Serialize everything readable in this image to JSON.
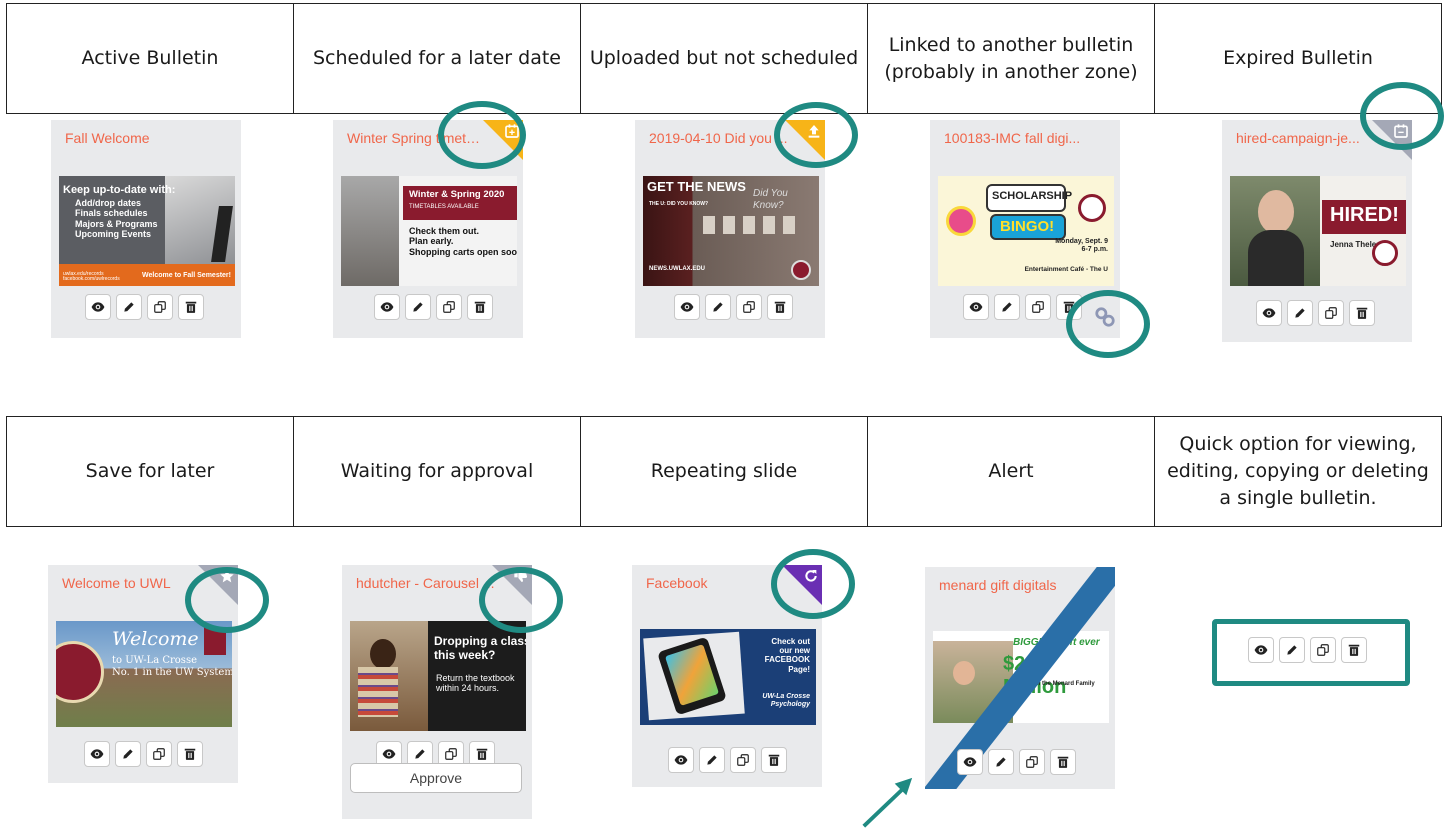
{
  "legend": {
    "row1": [
      "Active Bulletin",
      "Scheduled for a later date",
      "Uploaded but not scheduled",
      "Linked to another bulletin (probably in another zone)",
      "Expired Bulletin"
    ],
    "row2": [
      "Save for later",
      "Waiting for approval",
      "Repeating slide",
      "Alert",
      "Quick option for viewing, editing, copying or deleting a single bulletin."
    ]
  },
  "cards": {
    "active": {
      "title": "Fall Welcome",
      "thumb": {
        "line1": "Keep up-to-date with:",
        "items": "Add/drop dates\nFinals schedules\nMajors & Programs\nUpcoming Events",
        "footer_left": "uwlax.edu/records\nfacebook.com/uwlrecords",
        "footer_right": "Welcome to Fall Semester!"
      }
    },
    "scheduled": {
      "title": "Winter Spring timetables",
      "thumb": {
        "head": "Winter & Spring 2020",
        "sub": "TIMETABLES AVAILABLE",
        "body": "Check them out.\nPlan early.\nShopping carts open soon!"
      }
    },
    "uploaded": {
      "title": "2019-04-10 Did you ...",
      "thumb": {
        "head": "GET THE NEWS",
        "sub": "THE U: DID YOU KNOW?",
        "url": "NEWS.UWLAX.EDU",
        "wall": "Did You Know?"
      }
    },
    "linked": {
      "title": "100183-IMC fall digi...",
      "thumb": {
        "head": "SCHOLARSHIP",
        "bingo": "BINGO!",
        "date": "Monday, Sept. 9\n6-7 p.m.",
        "place": "Entertainment Café - The U"
      }
    },
    "expired": {
      "title": "hired-campaign-je...",
      "thumb": {
        "hired": "HIRED!",
        "name": "Jenna Thelen"
      }
    },
    "save": {
      "title": "Welcome to UWL",
      "thumb": {
        "head": "Welcome",
        "sub": "to UW-La Crosse\nNo. 1 in the UW System"
      }
    },
    "approval": {
      "title": "hdutcher - Carousel ...",
      "thumb": {
        "head": "Dropping a class\nthis week?",
        "body": "Return the textbook\nwithin 24 hours."
      },
      "approve_label": "Approve"
    },
    "repeating": {
      "title": "Facebook",
      "thumb": {
        "body": "Check out\nour new\nFACEBOOK\nPage!",
        "foot": "UW-La Crosse\nPsychology"
      }
    },
    "alert": {
      "title": "menard gift digitals",
      "thumb": {
        "head": "BIGGEST gift ever",
        "amount": "$2.1 Million",
        "sub": "from the Menard Family"
      }
    }
  },
  "icons": [
    "eye-icon",
    "pencil-icon",
    "copy-icon",
    "trash-icon",
    "calendar-plus-icon",
    "upload-icon",
    "link-icon",
    "calendar-minus-icon",
    "star-icon",
    "thumbs-down-icon",
    "repeat-icon",
    "arrow-icon"
  ],
  "colors": {
    "title": "#f0664a",
    "ring": "#1f8a82",
    "scheduled": "#f7b418",
    "expired": "#a4a8b6",
    "repeating": "#6a2fb3",
    "alert_stripe": "#2a6fa8"
  }
}
